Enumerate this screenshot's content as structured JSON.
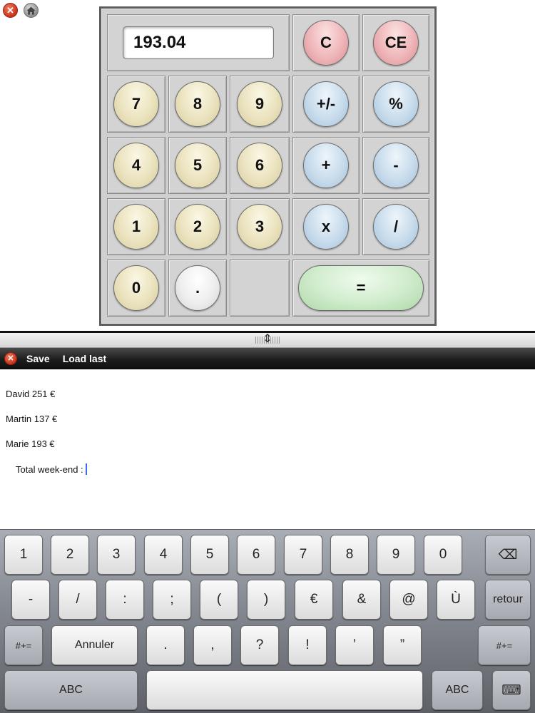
{
  "top_icons": {
    "close": "✕",
    "home": "⌂"
  },
  "calculator": {
    "display_value": "193.04",
    "clear_label": "C",
    "clear_entry_label": "CE",
    "digits": {
      "d7": "7",
      "d8": "8",
      "d9": "9",
      "d4": "4",
      "d5": "5",
      "d6": "6",
      "d1": "1",
      "d2": "2",
      "d3": "3",
      "d0": "0"
    },
    "decimal_label": ".",
    "plus_minus_label": "+/-",
    "percent_label": "%",
    "add_label": "+",
    "subtract_label": "-",
    "multiply_label": "x",
    "divide_label": "/",
    "equals_label": "="
  },
  "splitter": {
    "handle": "⇕"
  },
  "notes_toolbar": {
    "close": "✕",
    "save_label": "Save",
    "load_last_label": "Load last"
  },
  "notes": {
    "lines": [
      "David 251 €",
      "Martin 137 €",
      "Marie 193 €",
      "Total week-end :"
    ]
  },
  "keyboard": {
    "row1": [
      "1",
      "2",
      "3",
      "4",
      "5",
      "6",
      "7",
      "8",
      "9",
      "0"
    ],
    "backspace": "⌫",
    "row2": [
      "-",
      "/",
      ":",
      ";",
      "(",
      ")",
      "€",
      "&",
      "@",
      "Ù"
    ],
    "return_label": "retour",
    "symbols_label": "#+=",
    "cancel_label": "Annuler",
    "row3": [
      ".",
      ",",
      "?",
      "!",
      "’",
      "”"
    ],
    "abc_label": "ABC",
    "space_label": "",
    "hide_keyboard": "⌨"
  },
  "colors": {
    "caret": "#3a6ee8",
    "toolbar_bg": "#1e1e1e"
  }
}
